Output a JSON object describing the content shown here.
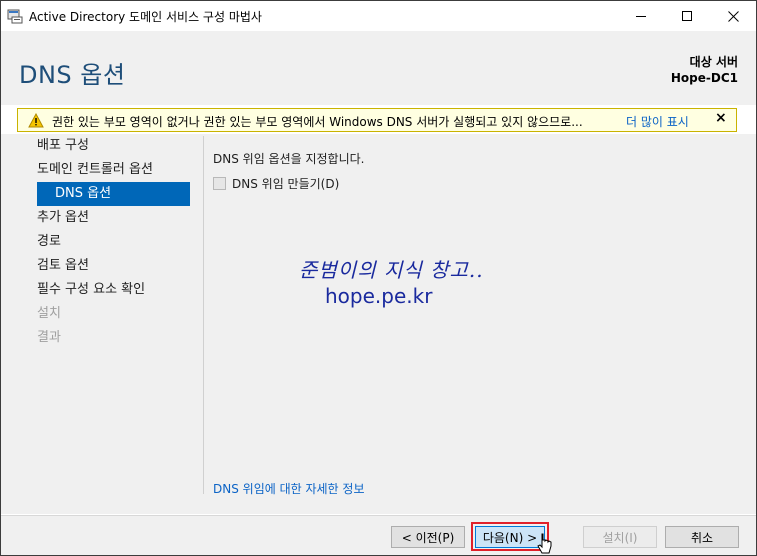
{
  "window": {
    "title": "Active Directory 도메인 서비스 구성 마법사",
    "icon": "ad-wizard-icon"
  },
  "header": {
    "page_title": "DNS 옵션",
    "target_label": "대상 서버",
    "target_value": "Hope-DC1"
  },
  "warning": {
    "text": "권한 있는 부모 영역이 없거나 권한 있는 부모 영역에서 Windows DNS 서버가 실행되고 있지 않으므로...",
    "more_link": "더 많이 표시",
    "close": "×"
  },
  "nav": {
    "items": [
      {
        "label": "배포 구성",
        "state": "normal"
      },
      {
        "label": "도메인 컨트롤러 옵션",
        "state": "normal"
      },
      {
        "label": "DNS 옵션",
        "state": "selected"
      },
      {
        "label": "추가 옵션",
        "state": "normal"
      },
      {
        "label": "경로",
        "state": "normal"
      },
      {
        "label": "검토 옵션",
        "state": "normal"
      },
      {
        "label": "필수 구성 요소 확인",
        "state": "normal"
      },
      {
        "label": "설치",
        "state": "disabled"
      },
      {
        "label": "결과",
        "state": "disabled"
      }
    ]
  },
  "main": {
    "description": "DNS 위임 옵션을 지정합니다.",
    "checkbox_label": "DNS 위임 만들기(D)",
    "checkbox_checked": false,
    "watermark_line1": "준범이의 지식 창고..",
    "watermark_line2": "hope.pe.kr",
    "more_info_link": "DNS 위임에 대한 자세한 정보"
  },
  "footer": {
    "prev_label": "< 이전(P)",
    "next_label": "다음(N) >",
    "install_label": "설치(I)",
    "cancel_label": "취소"
  },
  "colors": {
    "accent": "#0067b8",
    "title_blue": "#1e4e79",
    "warning_bg": "#ffffe1",
    "link": "#0b63c6",
    "highlight_border": "#e0202a"
  }
}
